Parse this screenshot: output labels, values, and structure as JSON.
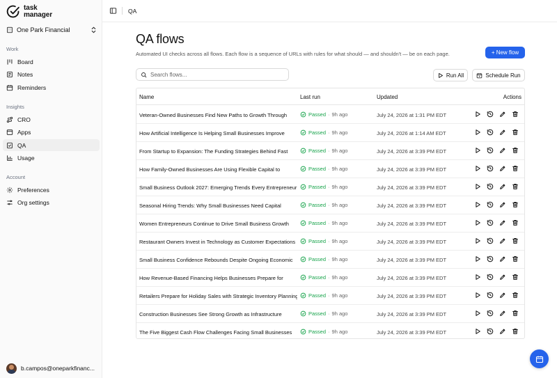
{
  "app": {
    "logo_line1": "task",
    "logo_line2": "manager"
  },
  "org": {
    "name": "One Park Financial"
  },
  "sidebar": {
    "groups": [
      {
        "label": "Work",
        "items": [
          {
            "label": "Board",
            "icon": "kanban-icon"
          },
          {
            "label": "Notes",
            "icon": "notes-icon"
          },
          {
            "label": "Reminders",
            "icon": "calendar-icon"
          }
        ]
      },
      {
        "label": "Insights",
        "items": [
          {
            "label": "CRO",
            "icon": "route-icon"
          },
          {
            "label": "Apps",
            "icon": "browser-icon"
          },
          {
            "label": "QA",
            "icon": "checklist-icon",
            "active": true
          },
          {
            "label": "Usage",
            "icon": "bar-chart-icon"
          }
        ]
      },
      {
        "label": "Account",
        "items": [
          {
            "label": "Preferences",
            "icon": "gear-icon"
          },
          {
            "label": "Org settings",
            "icon": "sliders-icon"
          }
        ]
      }
    ]
  },
  "user": {
    "email": "b.campos@oneparkfinanc..."
  },
  "topbar": {
    "breadcrumb": "QA"
  },
  "page": {
    "title": "QA flows",
    "description": "Automated UI checks across all flows. Each flow is a sequence of URLs with rules for what should — and shouldn't — be on each page.",
    "new_flow_label": "+ New flow",
    "search_placeholder": "Search flows...",
    "run_all_label": "Run All",
    "schedule_run_label": "Schedule Run"
  },
  "table": {
    "headers": {
      "name": "Name",
      "last_run": "Last run",
      "updated": "Updated",
      "actions": "Actions"
    },
    "rows": [
      {
        "name": "Veteran-Owned Businesses Find New Paths to Growth Through",
        "status": "Passed",
        "ago": "9h ago",
        "updated": "July 24, 2026 at 1:31 PM EDT"
      },
      {
        "name": "How Artificial Intelligence Is Helping Small Businesses Improve",
        "status": "Passed",
        "ago": "9h ago",
        "updated": "July 24, 2026 at 1:14 AM EDT"
      },
      {
        "name": "From Startup to Expansion: The Funding Strategies Behind Fast",
        "status": "Passed",
        "ago": "9h ago",
        "updated": "July 24, 2026 at 3:39 PM EDT"
      },
      {
        "name": "How Family-Owned Businesses Are Using Flexible Capital to",
        "status": "Passed",
        "ago": "9h ago",
        "updated": "July 24, 2026 at 3:39 PM EDT"
      },
      {
        "name": "Small Business Outlook 2027: Emerging Trends Every Entrepreneur",
        "status": "Passed",
        "ago": "9h ago",
        "updated": "July 24, 2026 at 3:39 PM EDT"
      },
      {
        "name": "Seasonal Hiring Trends: Why Small Businesses Need Capital",
        "status": "Passed",
        "ago": "9h ago",
        "updated": "July 24, 2026 at 3:39 PM EDT"
      },
      {
        "name": "Women Entrepreneurs Continue to Drive Small Business Growth",
        "status": "Passed",
        "ago": "9h ago",
        "updated": "July 24, 2026 at 3:39 PM EDT"
      },
      {
        "name": "Restaurant Owners Invest in Technology as Customer Expectations",
        "status": "Passed",
        "ago": "9h ago",
        "updated": "July 24, 2026 at 3:39 PM EDT"
      },
      {
        "name": "Small Business Confidence Rebounds Despite Ongoing Economic",
        "status": "Passed",
        "ago": "9h ago",
        "updated": "July 24, 2026 at 3:39 PM EDT"
      },
      {
        "name": "How Revenue-Based Financing Helps Businesses Prepare for",
        "status": "Passed",
        "ago": "9h ago",
        "updated": "July 24, 2026 at 3:39 PM EDT"
      },
      {
        "name": "Retailers Prepare for Holiday Sales with Strategic Inventory Planning",
        "status": "Passed",
        "ago": "9h ago",
        "updated": "July 24, 2026 at 3:39 PM EDT"
      },
      {
        "name": "Construction Businesses See Strong Growth as Infrastructure",
        "status": "Passed",
        "ago": "9h ago",
        "updated": "July 24, 2026 at 3:39 PM EDT"
      },
      {
        "name": "The Five Biggest Cash Flow Challenges Facing Small Businesses",
        "status": "Passed",
        "ago": "9h ago",
        "updated": "July 24, 2026 at 3:39 PM EDT"
      }
    ]
  },
  "colors": {
    "accent": "#2563eb",
    "success": "#16a34a"
  }
}
